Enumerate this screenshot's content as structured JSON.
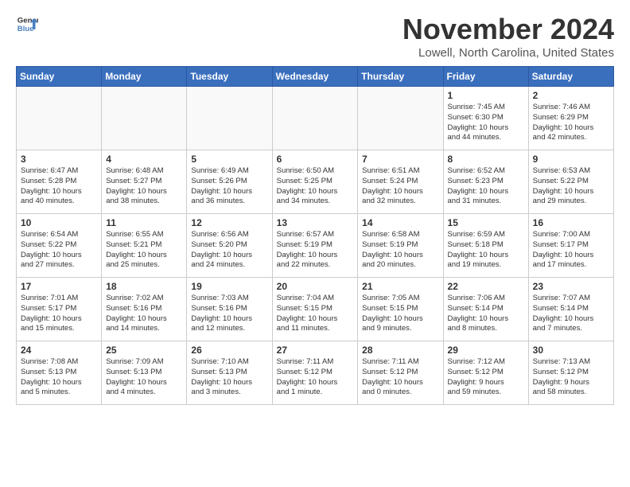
{
  "header": {
    "logo_line1": "General",
    "logo_line2": "Blue",
    "month": "November 2024",
    "location": "Lowell, North Carolina, United States"
  },
  "weekdays": [
    "Sunday",
    "Monday",
    "Tuesday",
    "Wednesday",
    "Thursday",
    "Friday",
    "Saturday"
  ],
  "weeks": [
    [
      {
        "day": "",
        "info": ""
      },
      {
        "day": "",
        "info": ""
      },
      {
        "day": "",
        "info": ""
      },
      {
        "day": "",
        "info": ""
      },
      {
        "day": "",
        "info": ""
      },
      {
        "day": "1",
        "info": "Sunrise: 7:45 AM\nSunset: 6:30 PM\nDaylight: 10 hours\nand 44 minutes."
      },
      {
        "day": "2",
        "info": "Sunrise: 7:46 AM\nSunset: 6:29 PM\nDaylight: 10 hours\nand 42 minutes."
      }
    ],
    [
      {
        "day": "3",
        "info": "Sunrise: 6:47 AM\nSunset: 5:28 PM\nDaylight: 10 hours\nand 40 minutes."
      },
      {
        "day": "4",
        "info": "Sunrise: 6:48 AM\nSunset: 5:27 PM\nDaylight: 10 hours\nand 38 minutes."
      },
      {
        "day": "5",
        "info": "Sunrise: 6:49 AM\nSunset: 5:26 PM\nDaylight: 10 hours\nand 36 minutes."
      },
      {
        "day": "6",
        "info": "Sunrise: 6:50 AM\nSunset: 5:25 PM\nDaylight: 10 hours\nand 34 minutes."
      },
      {
        "day": "7",
        "info": "Sunrise: 6:51 AM\nSunset: 5:24 PM\nDaylight: 10 hours\nand 32 minutes."
      },
      {
        "day": "8",
        "info": "Sunrise: 6:52 AM\nSunset: 5:23 PM\nDaylight: 10 hours\nand 31 minutes."
      },
      {
        "day": "9",
        "info": "Sunrise: 6:53 AM\nSunset: 5:22 PM\nDaylight: 10 hours\nand 29 minutes."
      }
    ],
    [
      {
        "day": "10",
        "info": "Sunrise: 6:54 AM\nSunset: 5:22 PM\nDaylight: 10 hours\nand 27 minutes."
      },
      {
        "day": "11",
        "info": "Sunrise: 6:55 AM\nSunset: 5:21 PM\nDaylight: 10 hours\nand 25 minutes."
      },
      {
        "day": "12",
        "info": "Sunrise: 6:56 AM\nSunset: 5:20 PM\nDaylight: 10 hours\nand 24 minutes."
      },
      {
        "day": "13",
        "info": "Sunrise: 6:57 AM\nSunset: 5:19 PM\nDaylight: 10 hours\nand 22 minutes."
      },
      {
        "day": "14",
        "info": "Sunrise: 6:58 AM\nSunset: 5:19 PM\nDaylight: 10 hours\nand 20 minutes."
      },
      {
        "day": "15",
        "info": "Sunrise: 6:59 AM\nSunset: 5:18 PM\nDaylight: 10 hours\nand 19 minutes."
      },
      {
        "day": "16",
        "info": "Sunrise: 7:00 AM\nSunset: 5:17 PM\nDaylight: 10 hours\nand 17 minutes."
      }
    ],
    [
      {
        "day": "17",
        "info": "Sunrise: 7:01 AM\nSunset: 5:17 PM\nDaylight: 10 hours\nand 15 minutes."
      },
      {
        "day": "18",
        "info": "Sunrise: 7:02 AM\nSunset: 5:16 PM\nDaylight: 10 hours\nand 14 minutes."
      },
      {
        "day": "19",
        "info": "Sunrise: 7:03 AM\nSunset: 5:16 PM\nDaylight: 10 hours\nand 12 minutes."
      },
      {
        "day": "20",
        "info": "Sunrise: 7:04 AM\nSunset: 5:15 PM\nDaylight: 10 hours\nand 11 minutes."
      },
      {
        "day": "21",
        "info": "Sunrise: 7:05 AM\nSunset: 5:15 PM\nDaylight: 10 hours\nand 9 minutes."
      },
      {
        "day": "22",
        "info": "Sunrise: 7:06 AM\nSunset: 5:14 PM\nDaylight: 10 hours\nand 8 minutes."
      },
      {
        "day": "23",
        "info": "Sunrise: 7:07 AM\nSunset: 5:14 PM\nDaylight: 10 hours\nand 7 minutes."
      }
    ],
    [
      {
        "day": "24",
        "info": "Sunrise: 7:08 AM\nSunset: 5:13 PM\nDaylight: 10 hours\nand 5 minutes."
      },
      {
        "day": "25",
        "info": "Sunrise: 7:09 AM\nSunset: 5:13 PM\nDaylight: 10 hours\nand 4 minutes."
      },
      {
        "day": "26",
        "info": "Sunrise: 7:10 AM\nSunset: 5:13 PM\nDaylight: 10 hours\nand 3 minutes."
      },
      {
        "day": "27",
        "info": "Sunrise: 7:11 AM\nSunset: 5:12 PM\nDaylight: 10 hours\nand 1 minute."
      },
      {
        "day": "28",
        "info": "Sunrise: 7:11 AM\nSunset: 5:12 PM\nDaylight: 10 hours\nand 0 minutes."
      },
      {
        "day": "29",
        "info": "Sunrise: 7:12 AM\nSunset: 5:12 PM\nDaylight: 9 hours\nand 59 minutes."
      },
      {
        "day": "30",
        "info": "Sunrise: 7:13 AM\nSunset: 5:12 PM\nDaylight: 9 hours\nand 58 minutes."
      }
    ]
  ]
}
